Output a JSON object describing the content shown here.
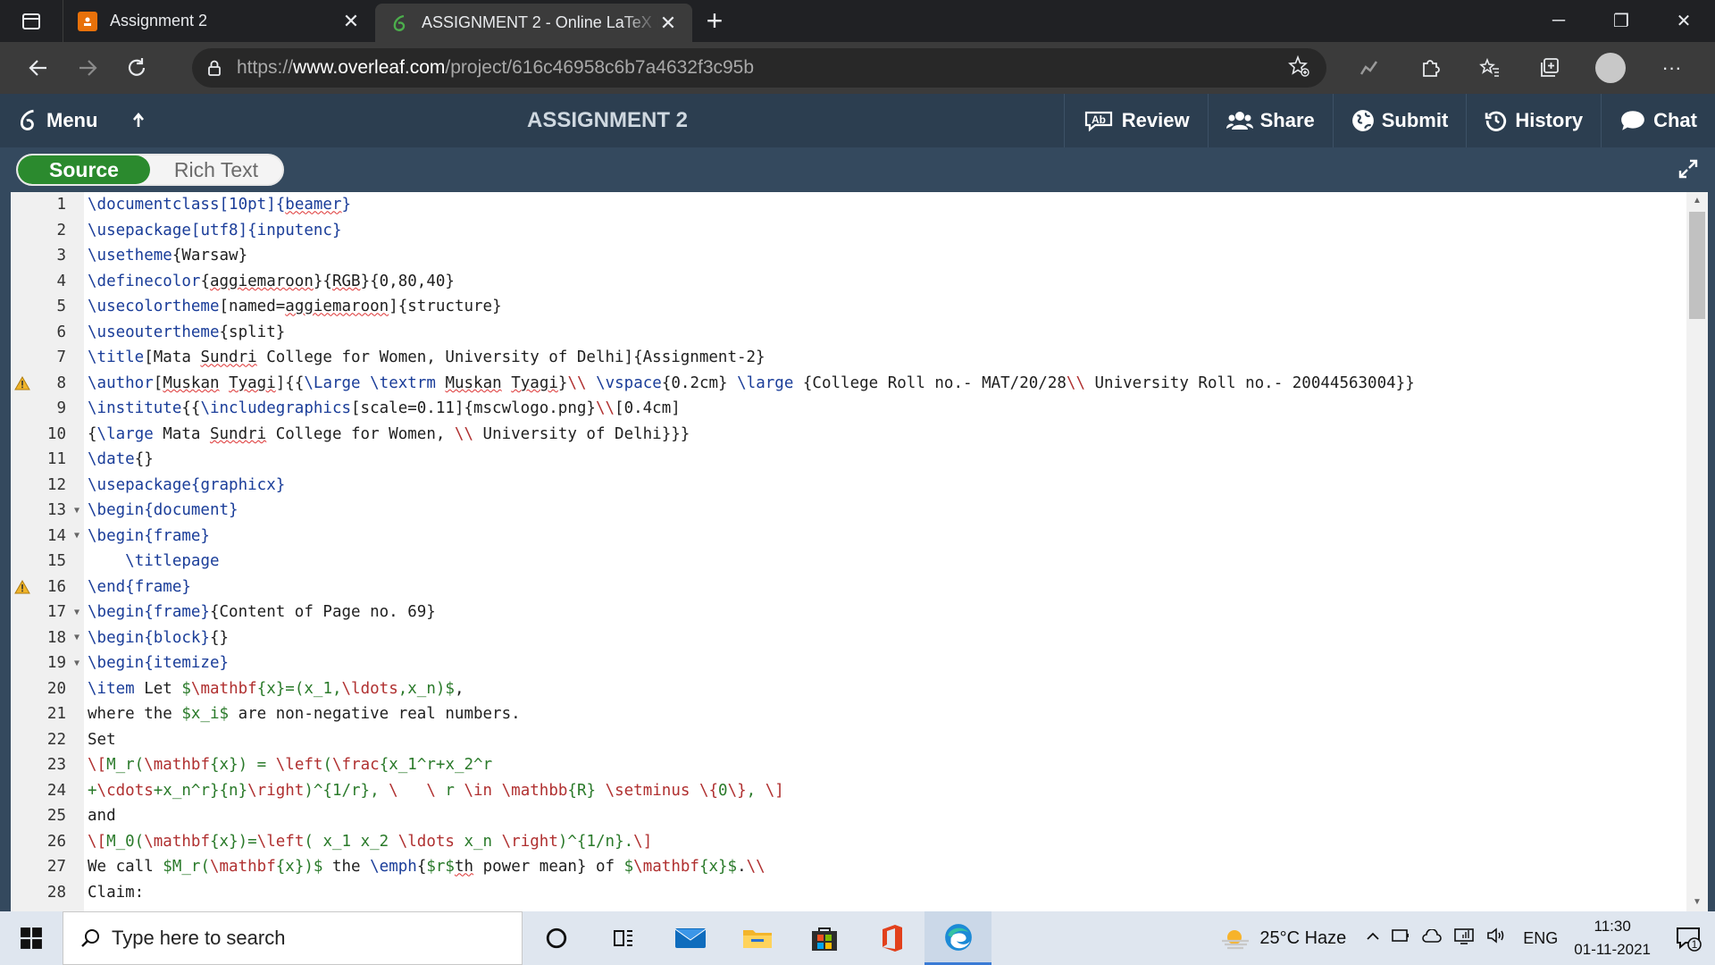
{
  "browser": {
    "tabs": [
      {
        "title": "Assignment 2",
        "active": false,
        "favicon_color": "#e8710a"
      },
      {
        "title": "ASSIGNMENT 2 - Online LaTeX E",
        "active": true,
        "favicon_color": "#4cae4c"
      }
    ],
    "url_prefix": "https://",
    "url_host": "www.overleaf.com",
    "url_path": "/project/616c46958c6b7a4632f3c95b"
  },
  "overleaf": {
    "menu_label": "Menu",
    "project_title": "ASSIGNMENT 2",
    "actions": [
      "Review",
      "Share",
      "Submit",
      "History",
      "Chat"
    ],
    "toggle": {
      "source": "Source",
      "rich": "Rich Text"
    },
    "accent_green": "#2b8a2e",
    "toolbar_color": "#2c3e50"
  },
  "editor": {
    "lines": [
      {
        "n": "1",
        "fold": false,
        "warn": false
      },
      {
        "n": "2",
        "fold": false,
        "warn": false
      },
      {
        "n": "3",
        "fold": false,
        "warn": false
      },
      {
        "n": "4",
        "fold": false,
        "warn": false
      },
      {
        "n": "5",
        "fold": false,
        "warn": false
      },
      {
        "n": "6",
        "fold": false,
        "warn": false
      },
      {
        "n": "7",
        "fold": false,
        "warn": false
      },
      {
        "n": "8",
        "fold": false,
        "warn": true
      },
      {
        "n": "9",
        "fold": false,
        "warn": false
      },
      {
        "n": "10",
        "fold": false,
        "warn": false
      },
      {
        "n": "11",
        "fold": false,
        "warn": false
      },
      {
        "n": "12",
        "fold": false,
        "warn": false
      },
      {
        "n": "13",
        "fold": true,
        "warn": false
      },
      {
        "n": "14",
        "fold": true,
        "warn": false
      },
      {
        "n": "15",
        "fold": false,
        "warn": false
      },
      {
        "n": "16",
        "fold": false,
        "warn": true
      },
      {
        "n": "17",
        "fold": true,
        "warn": false
      },
      {
        "n": "18",
        "fold": true,
        "warn": false
      },
      {
        "n": "19",
        "fold": true,
        "warn": false
      },
      {
        "n": "20",
        "fold": false,
        "warn": false
      },
      {
        "n": "21",
        "fold": false,
        "warn": false
      },
      {
        "n": "22",
        "fold": false,
        "warn": false
      },
      {
        "n": "23",
        "fold": false,
        "warn": false
      },
      {
        "n": "24",
        "fold": false,
        "warn": false
      },
      {
        "n": "25",
        "fold": false,
        "warn": false
      },
      {
        "n": "26",
        "fold": false,
        "warn": false
      },
      {
        "n": "27",
        "fold": false,
        "warn": false
      },
      {
        "n": "28",
        "fold": false,
        "warn": false
      }
    ],
    "code": [
      [
        [
          "c",
          "\\documentclass"
        ],
        [
          "c",
          "[10pt]{"
        ],
        [
          "cu",
          "beamer"
        ],
        [
          "c",
          "}"
        ]
      ],
      [
        [
          "c",
          "\\usepackage"
        ],
        [
          "c",
          "[utf8]{inputenc}"
        ]
      ],
      [
        [
          "c",
          "\\usetheme"
        ],
        [
          "t",
          "{Warsaw}"
        ]
      ],
      [
        [
          "c",
          "\\definecolor"
        ],
        [
          "t",
          "{"
        ],
        [
          "u",
          "aggiemaroon"
        ],
        [
          "t",
          "}{"
        ],
        [
          "u",
          "RGB"
        ],
        [
          "t",
          "}{0,80,40}"
        ]
      ],
      [
        [
          "c",
          "\\usecolortheme"
        ],
        [
          "t",
          "[named="
        ],
        [
          "u",
          "aggiemaroon"
        ],
        [
          "t",
          "]{structure}"
        ]
      ],
      [
        [
          "c",
          "\\useoutertheme"
        ],
        [
          "t",
          "{split}"
        ]
      ],
      [
        [
          "c",
          "\\title"
        ],
        [
          "t",
          "[Mata "
        ],
        [
          "u",
          "Sundri"
        ],
        [
          "t",
          " College for Women, University of Delhi]{Assignment-2}"
        ]
      ],
      [
        [
          "c",
          "\\author"
        ],
        [
          "t",
          "["
        ],
        [
          "u",
          "Muskan"
        ],
        [
          "t",
          " "
        ],
        [
          "u",
          "Tyagi"
        ],
        [
          "t",
          "]{{"
        ],
        [
          "c",
          "\\Large"
        ],
        [
          "t",
          " "
        ],
        [
          "c",
          "\\textrm"
        ],
        [
          "t",
          " "
        ],
        [
          "u",
          "Muskan"
        ],
        [
          "t",
          " "
        ],
        [
          "u",
          "Tyagi"
        ],
        [
          "t",
          "}"
        ],
        [
          "m",
          "\\\\"
        ],
        [
          "t",
          " "
        ],
        [
          "c",
          "\\vspace"
        ],
        [
          "t",
          "{0.2cm} "
        ],
        [
          "c",
          "\\large"
        ],
        [
          "t",
          " {College Roll no.- MAT/20/28"
        ],
        [
          "m",
          "\\\\"
        ],
        [
          "t",
          " University Roll no.- 20044563004}}"
        ]
      ],
      [
        [
          "c",
          "\\institute"
        ],
        [
          "t",
          "{{"
        ],
        [
          "c",
          "\\includegraphics"
        ],
        [
          "t",
          "[scale=0.11]{mscwlogo.png}"
        ],
        [
          "m",
          "\\\\"
        ],
        [
          "t",
          "[0.4cm]"
        ]
      ],
      [
        [
          "t",
          "{"
        ],
        [
          "c",
          "\\large"
        ],
        [
          "t",
          " Mata "
        ],
        [
          "u",
          "Sundri"
        ],
        [
          "t",
          " College for Women, "
        ],
        [
          "m",
          "\\\\"
        ],
        [
          "t",
          " University of Delhi}}}"
        ]
      ],
      [
        [
          "c",
          "\\date"
        ],
        [
          "t",
          "{}"
        ]
      ],
      [
        [
          "c",
          "\\usepackage"
        ],
        [
          "c",
          "{graphicx}"
        ]
      ],
      [
        [
          "c",
          "\\begin"
        ],
        [
          "c",
          "{document}"
        ]
      ],
      [
        [
          "c",
          "\\begin"
        ],
        [
          "c",
          "{frame}"
        ]
      ],
      [
        [
          "t",
          "    "
        ],
        [
          "c",
          "\\titlepage"
        ]
      ],
      [
        [
          "c",
          "\\end"
        ],
        [
          "c",
          "{frame}"
        ]
      ],
      [
        [
          "c",
          "\\begin"
        ],
        [
          "c",
          "{frame}"
        ],
        [
          "t",
          "{Content of Page no. 69}"
        ]
      ],
      [
        [
          "c",
          "\\begin"
        ],
        [
          "c",
          "{block}"
        ],
        [
          "t",
          "{}"
        ]
      ],
      [
        [
          "c",
          "\\begin"
        ],
        [
          "c",
          "{itemize}"
        ]
      ],
      [
        [
          "c",
          "\\item"
        ],
        [
          "t",
          " Let "
        ],
        [
          "g",
          "$"
        ],
        [
          "m",
          "\\mathbf"
        ],
        [
          "g",
          "{x}=(x_1,"
        ],
        [
          "m",
          "\\ldots"
        ],
        [
          "g",
          ",x_n)$"
        ],
        [
          "t",
          ","
        ]
      ],
      [
        [
          "t",
          "where the "
        ],
        [
          "g",
          "$x_i$"
        ],
        [
          "t",
          " are non-negative real numbers."
        ]
      ],
      [
        [
          "t",
          "Set"
        ]
      ],
      [
        [
          "m",
          "\\["
        ],
        [
          "g",
          "M_r("
        ],
        [
          "m",
          "\\mathbf"
        ],
        [
          "g",
          "{x}) = "
        ],
        [
          "m",
          "\\left"
        ],
        [
          "g",
          "("
        ],
        [
          "m",
          "\\frac"
        ],
        [
          "g",
          "{x_1^r+x_2^r"
        ]
      ],
      [
        [
          "g",
          "+"
        ],
        [
          "m",
          "\\cdots"
        ],
        [
          "g",
          "+x_n^r}{n}"
        ],
        [
          "m",
          "\\right"
        ],
        [
          "g",
          ")^{1/r}, "
        ],
        [
          "m",
          "\\ "
        ],
        [
          "g",
          "  "
        ],
        [
          "m",
          "\\ "
        ],
        [
          "g",
          "r "
        ],
        [
          "m",
          "\\in"
        ],
        [
          "g",
          " "
        ],
        [
          "m",
          "\\mathbb"
        ],
        [
          "g",
          "{R} "
        ],
        [
          "m",
          "\\setminus"
        ],
        [
          "g",
          " "
        ],
        [
          "m",
          "\\{"
        ],
        [
          "g",
          "0"
        ],
        [
          "m",
          "\\}"
        ],
        [
          "g",
          ", "
        ],
        [
          "m",
          "\\]"
        ]
      ],
      [
        [
          "t",
          "and"
        ]
      ],
      [
        [
          "m",
          "\\["
        ],
        [
          "g",
          "M_0("
        ],
        [
          "m",
          "\\mathbf"
        ],
        [
          "g",
          "{x})="
        ],
        [
          "m",
          "\\left"
        ],
        [
          "g",
          "( x_1 x_2 "
        ],
        [
          "m",
          "\\ldots"
        ],
        [
          "g",
          " x_n "
        ],
        [
          "m",
          "\\right"
        ],
        [
          "g",
          ")^{1/n}."
        ],
        [
          "m",
          "\\]"
        ]
      ],
      [
        [
          "t",
          "We call "
        ],
        [
          "g",
          "$M_r("
        ],
        [
          "m",
          "\\mathbf"
        ],
        [
          "g",
          "{x})$"
        ],
        [
          "t",
          " the "
        ],
        [
          "c",
          "\\emph"
        ],
        [
          "t",
          "{"
        ],
        [
          "g",
          "$r$"
        ],
        [
          "u",
          "th"
        ],
        [
          "t",
          " power mean} of "
        ],
        [
          "g",
          "$"
        ],
        [
          "m",
          "\\mathbf"
        ],
        [
          "g",
          "{x}$"
        ],
        [
          "t",
          "."
        ],
        [
          "m",
          "\\\\"
        ]
      ],
      [
        [
          "t",
          "Claim:"
        ]
      ]
    ]
  },
  "taskbar": {
    "search_placeholder": "Type here to search",
    "weather": "25°C  Haze",
    "lang": "ENG",
    "time": "11:30",
    "date": "01-11-2021",
    "notif_count": "1"
  }
}
